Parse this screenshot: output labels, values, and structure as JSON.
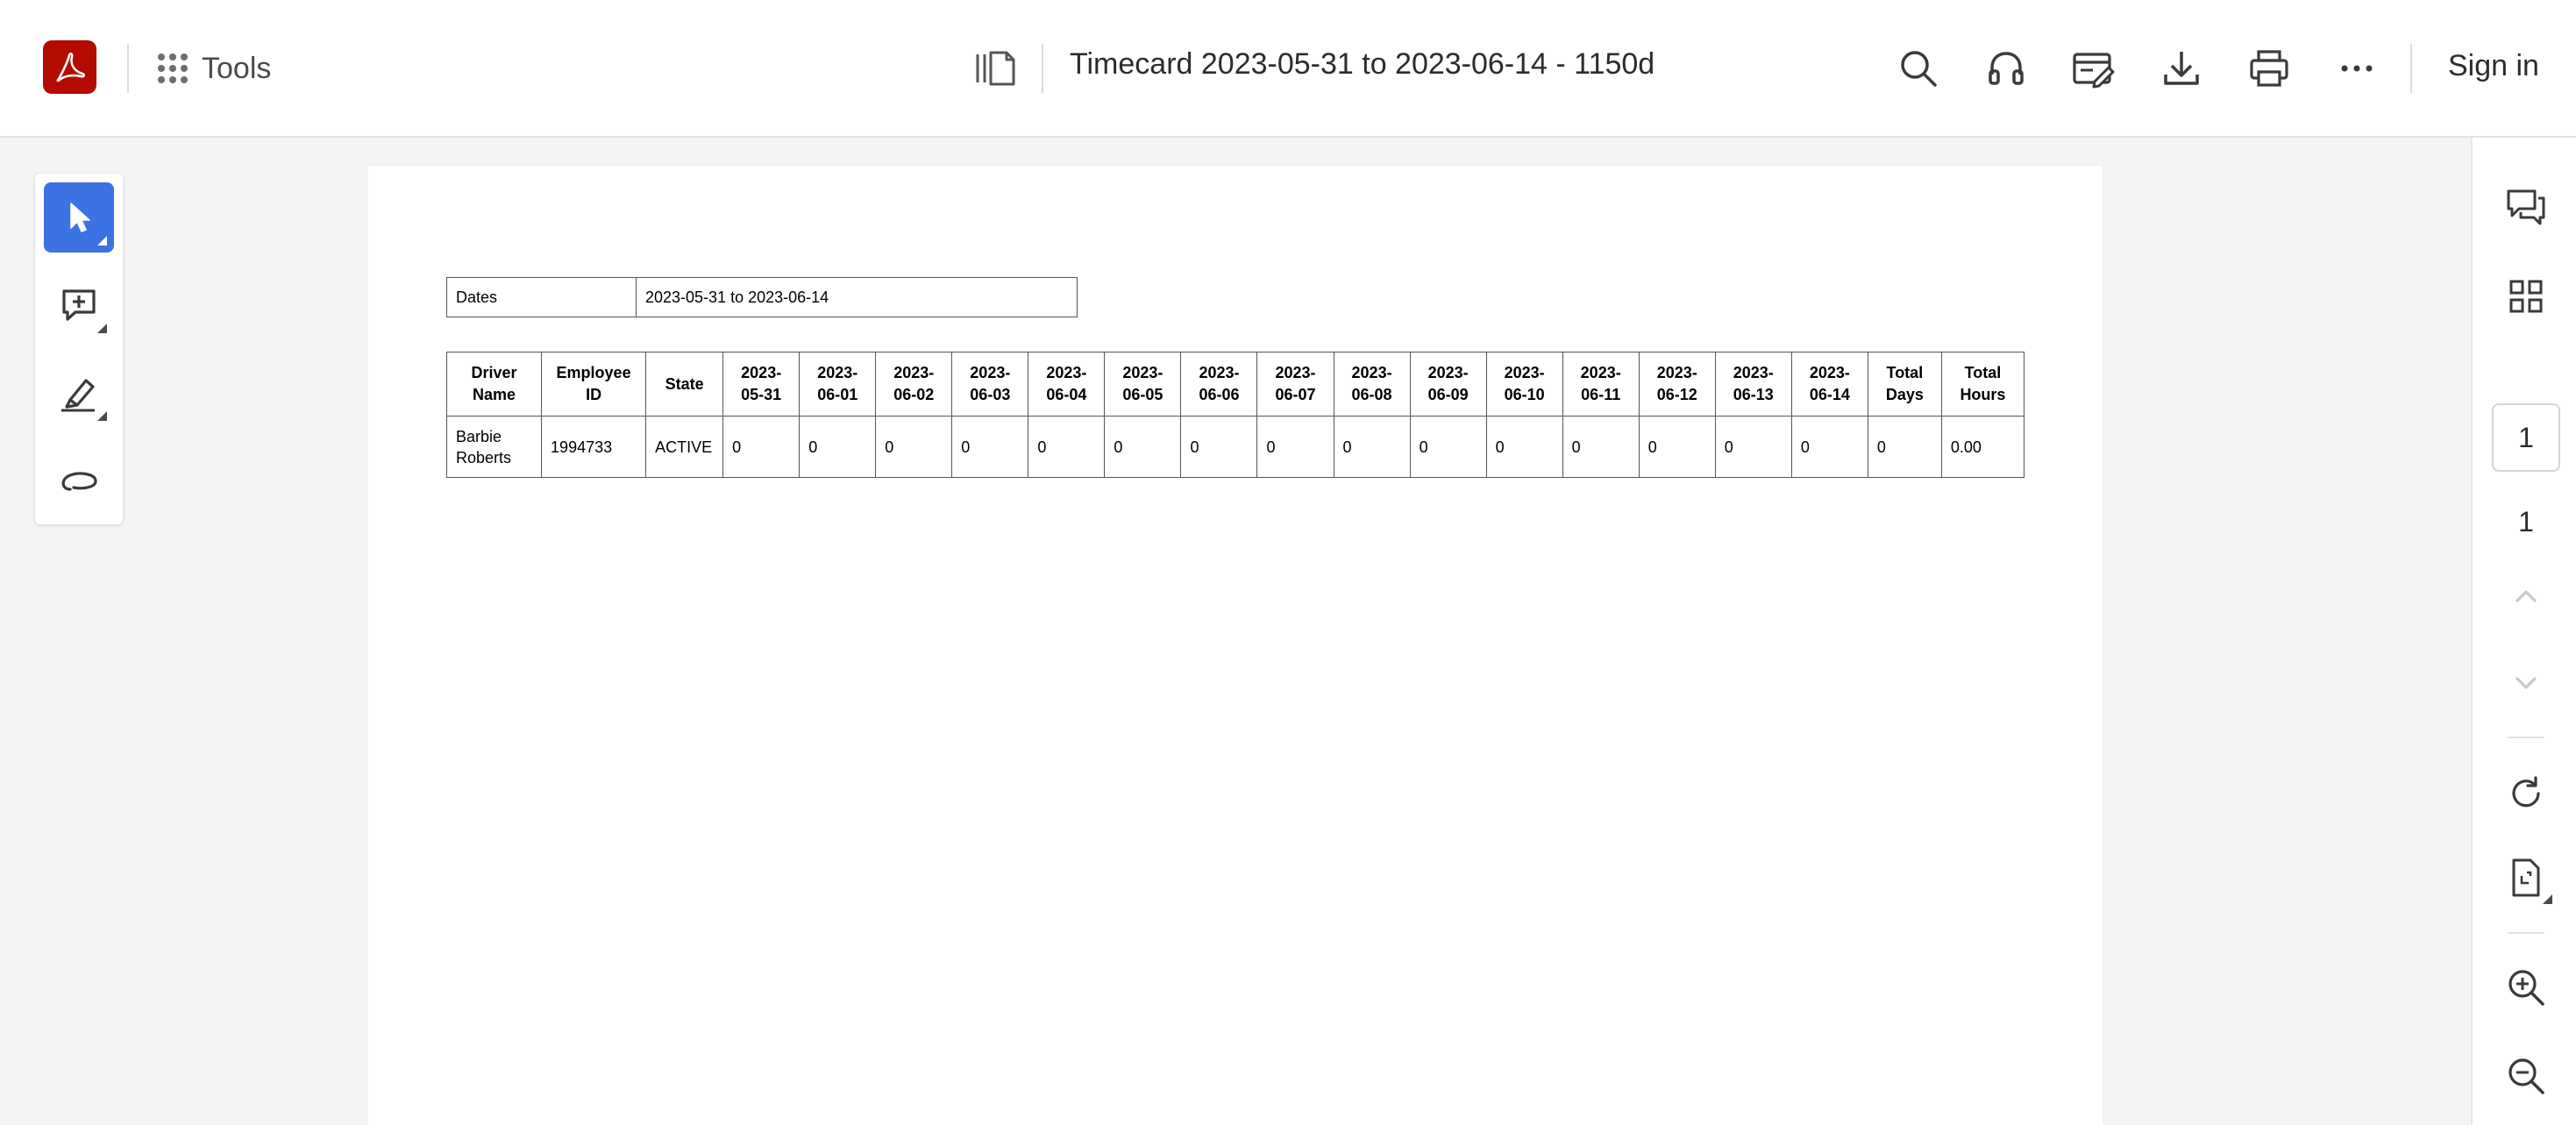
{
  "app": {
    "tools_label": "Tools",
    "document_title": "Timecard 2023-05-31 to 2023-06-14 - 1150d",
    "sign_in_label": "Sign in",
    "brand_color": "#b30b00",
    "accent_color": "#3b73e3"
  },
  "top_icons": [
    "search-icon",
    "read-aloud-icon",
    "sign-icon",
    "download-icon",
    "print-icon",
    "more-icon"
  ],
  "left_tools": [
    "select-tool",
    "add-comment-tool",
    "highlight-tool",
    "draw-tool"
  ],
  "document": {
    "dates_label": "Dates",
    "dates_value": "2023-05-31 to 2023-06-14",
    "headers": [
      "Driver Name",
      "Employee ID",
      "State",
      "2023-05-31",
      "2023-06-01",
      "2023-06-02",
      "2023-06-03",
      "2023-06-04",
      "2023-06-05",
      "2023-06-06",
      "2023-06-07",
      "2023-06-08",
      "2023-06-09",
      "2023-06-10",
      "2023-06-11",
      "2023-06-12",
      "2023-06-13",
      "2023-06-14",
      "Total Days",
      "Total Hours"
    ],
    "rows": [
      [
        "Barbie Roberts",
        "1994733",
        "ACTIVE",
        "0",
        "0",
        "0",
        "0",
        "0",
        "0",
        "0",
        "0",
        "0",
        "0",
        "0",
        "0",
        "0",
        "0",
        "0",
        "0",
        "0.00"
      ]
    ]
  },
  "pagination": {
    "current_page": "1",
    "total_pages": "1"
  }
}
